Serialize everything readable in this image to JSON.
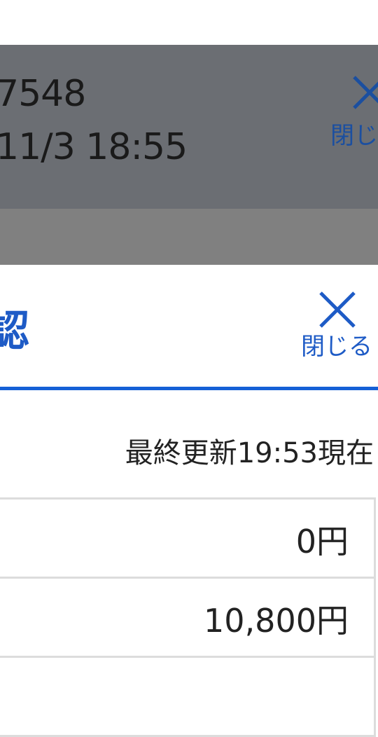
{
  "background_sheet": {
    "line1": "7548",
    "line2": "11/3 18:55",
    "close_label": "閉じ"
  },
  "dialog": {
    "title": "認",
    "close_label": "閉じる",
    "last_updated": "最終更新19:53現在",
    "rows": [
      {
        "value": "0円"
      },
      {
        "value": "10,800円"
      },
      {
        "value": ""
      }
    ]
  },
  "colors": {
    "accent": "#1e5bc6",
    "header_underline": "#1560d6",
    "overlay": "#6b6e73",
    "band": "#808080"
  }
}
